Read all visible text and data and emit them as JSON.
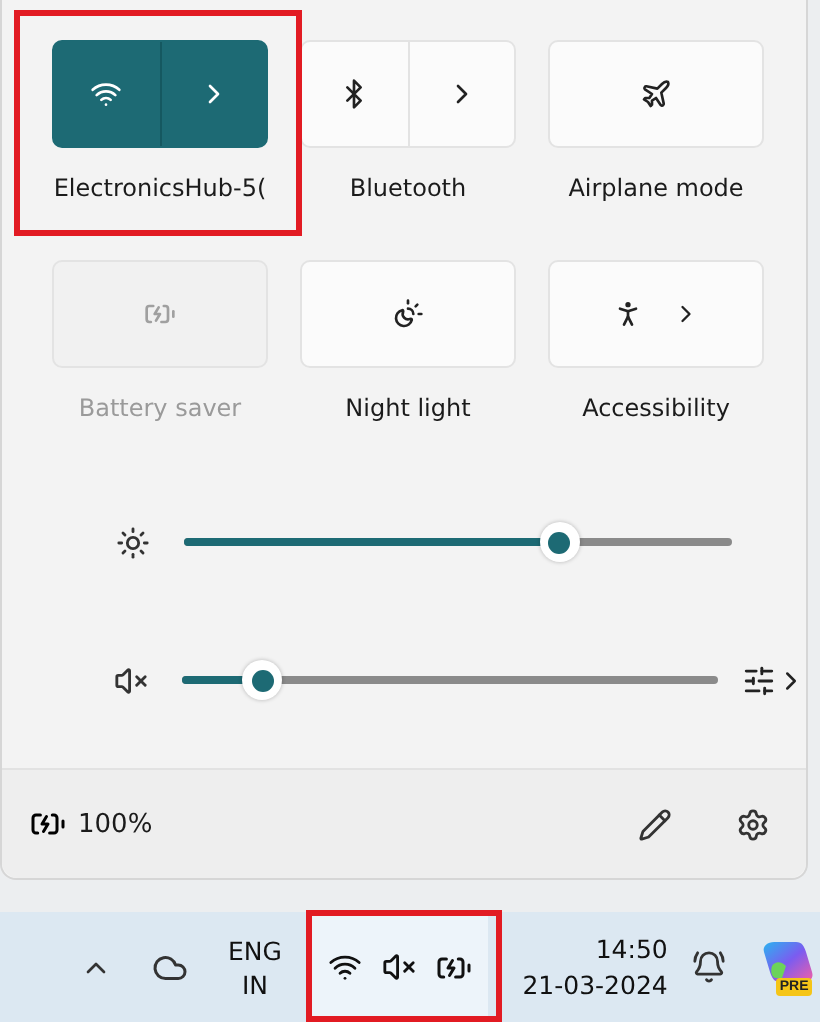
{
  "quick_tiles": [
    {
      "kind": "wifi",
      "label": "ElectronicsHub-5(",
      "selected": true,
      "disabled": false,
      "split": true
    },
    {
      "kind": "bluetooth",
      "label": "Bluetooth",
      "selected": false,
      "disabled": false,
      "split": true
    },
    {
      "kind": "airplane",
      "label": "Airplane mode",
      "selected": false,
      "disabled": false,
      "split": false
    },
    {
      "kind": "battery-saver",
      "label": "Battery saver",
      "selected": false,
      "disabled": true,
      "split": false
    },
    {
      "kind": "night-light",
      "label": "Night light",
      "selected": false,
      "disabled": false,
      "split": false
    },
    {
      "kind": "accessibility",
      "label": "Accessibility",
      "selected": false,
      "disabled": false,
      "split": false,
      "chevron": true
    }
  ],
  "sliders": [
    {
      "kind": "brightness",
      "level": 0.686
    },
    {
      "kind": "volume",
      "level": 0.146,
      "muted": true
    }
  ],
  "footer": {
    "battery": "100%"
  },
  "taskbar": {
    "language": [
      "ENG",
      "IN"
    ],
    "time": "14:50",
    "date": "21-03-2024",
    "copilot_badge": "PRE",
    "muted": true
  }
}
